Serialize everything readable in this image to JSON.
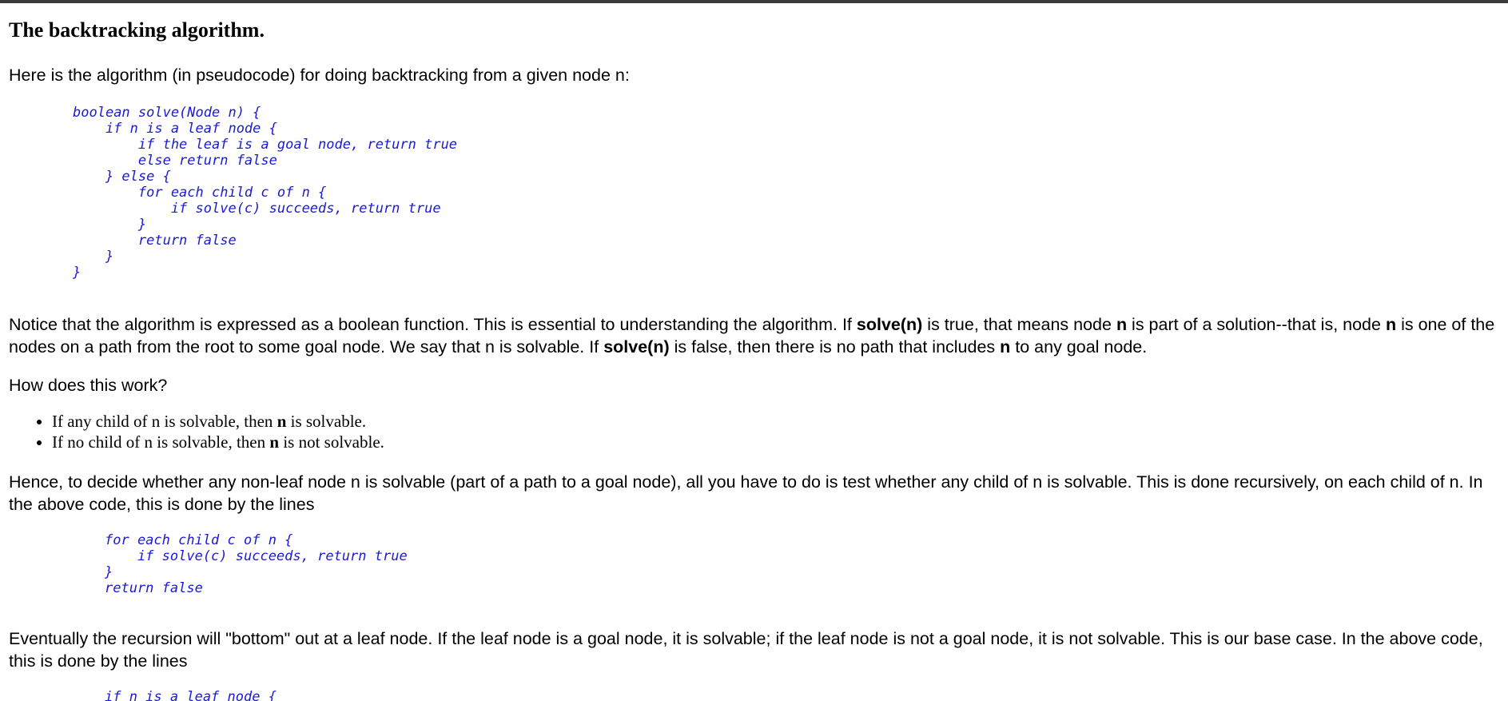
{
  "heading": "The backtracking algorithm.",
  "intro": "Here is the algorithm (in pseudocode) for doing backtracking from a given node n:",
  "code_main": "boolean solve(Node n) {\n    if n is a leaf node {\n        if the leaf is a goal node, return true\n        else return false\n    } else {\n        for each child c of n {\n            if solve(c) succeeds, return true\n        }\n        return false\n    }\n}",
  "notice": {
    "t1": "Notice that the algorithm is expressed as a boolean function. This is essential to understanding the algorithm. If ",
    "b1": "solve(n)",
    "t2": " is true, that means node ",
    "b2": "n",
    "t3": " is part of a solution--that is, node ",
    "b3": "n",
    "t4": " is one of the nodes on a path from the root to some goal node. We say that n is solvable. If ",
    "b4": "solve(n)",
    "t5": " is false, then there is no path that includes ",
    "b5": "n",
    "t6": " to any goal node."
  },
  "how": "How does this work?",
  "bullets": [
    {
      "pre": "If any child of n is solvable, then ",
      "bold": "n",
      "post": " is solvable."
    },
    {
      "pre": "If no child of n is solvable, then ",
      "bold": "n",
      "post": " is not solvable."
    }
  ],
  "hence": "Hence, to decide whether any non-leaf node n is solvable (part of a path to a goal node), all you have to do is test whether any child of n is solvable. This is done recursively, on each child of n. In the above code, this is done by the lines",
  "code_loop": "for each child c of n {\n    if solve(c) succeeds, return true\n}\nreturn false",
  "eventually": "Eventually the recursion will \"bottom\" out at a leaf node. If the leaf node is a goal node, it is solvable; if the leaf node is not a goal node, it is not solvable. This is our base case. In the above code, this is done by the lines",
  "code_leaf": "if n is a leaf node {"
}
